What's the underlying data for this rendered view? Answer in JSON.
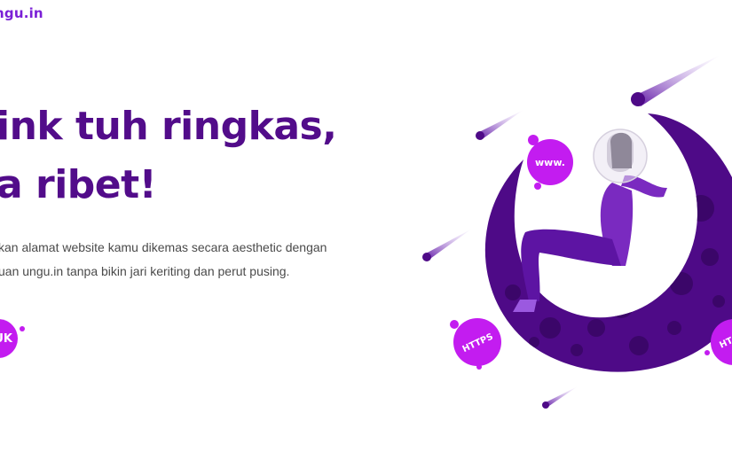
{
  "header": {
    "logo_text": "ngu.in"
  },
  "hero": {
    "headline_line1": "ink tuh ringkas,",
    "headline_line2": "a ribet!",
    "desc_line1": "kan alamat website kamu dikemas secara aesthetic dengan",
    "desc_line2": "uan ungu.in tanpa bikin jari keriting dan perut pusing.",
    "cta_label": "UK"
  },
  "illustration": {
    "bubble_www": "www.",
    "bubble_https_1": "HTTPS",
    "bubble_https_2": "HT"
  },
  "colors": {
    "brand": "#7a1fd6",
    "headline": "#520c8a",
    "accent_magenta": "#c31cf0",
    "moon": "#4e0a87",
    "moon_crater": "#3b0669"
  }
}
